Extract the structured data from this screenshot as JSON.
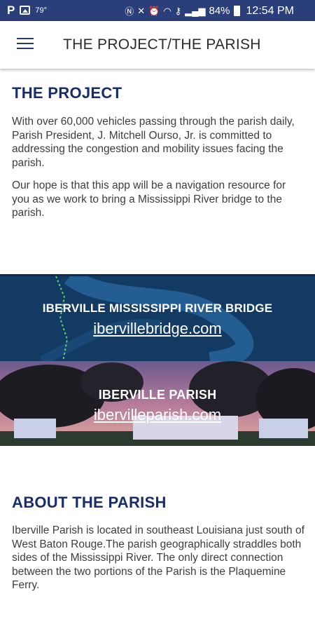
{
  "status_bar": {
    "temp": "79°",
    "battery": "84%",
    "time": "12:54 PM"
  },
  "app_bar": {
    "title": "THE PROJECT/THE PARISH"
  },
  "project": {
    "heading": "THE PROJECT",
    "para1": "With over 60,000 vehicles passing through the parish daily, Parish President, J. Mitchell Ourso, Jr. is committed to addressing the congestion and mobility issues facing the parish.",
    "para2": "Our hope is that this app will be a navigation resource for you as we work to bring a Mississippi River bridge to the parish."
  },
  "banners": {
    "bridge": {
      "title": "IBERVILLE MISSISSIPPI RIVER BRIDGE",
      "link": "ibervillebridge.com"
    },
    "parish": {
      "title": "IBERVILLE PARISH",
      "link": "ibervilleparish.com"
    }
  },
  "about": {
    "heading": "ABOUT THE PARISH",
    "para": "Iberville Parish is located in southeast Louisiana just south of West Baton Rouge.The parish geographically straddles both sides of the Mississippi River. The only direct connection between the two portions of the Parish is the Plaquemine Ferry."
  },
  "colors": {
    "status_bar": "#2a3f7a",
    "heading": "#1a2d6b",
    "bridge_banner": "#123a63"
  }
}
